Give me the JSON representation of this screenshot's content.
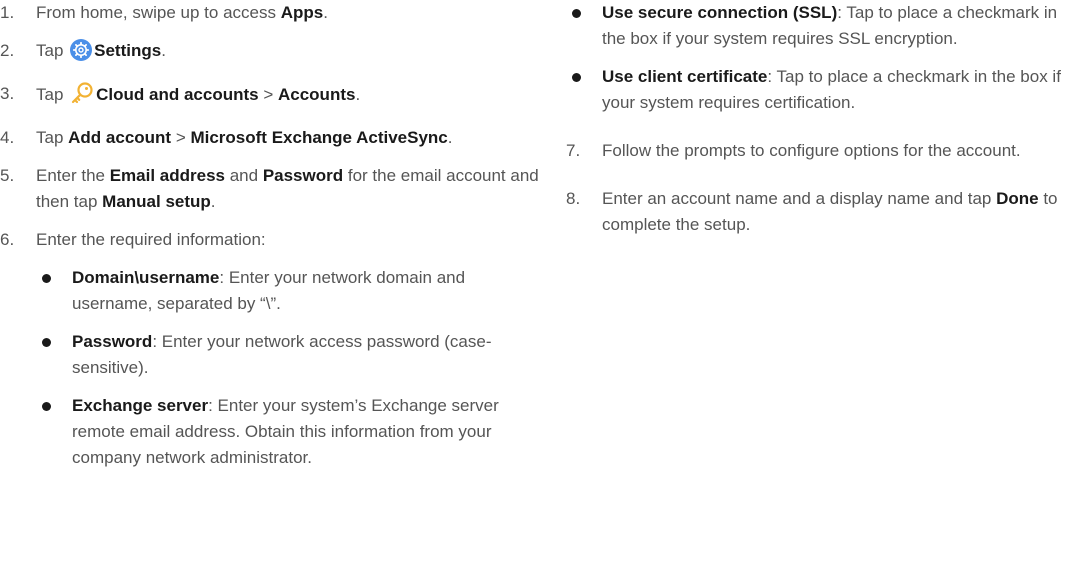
{
  "steps": [
    {
      "num": "1.",
      "pre": "From home, swipe up to access ",
      "b1": "Apps",
      "post": "."
    },
    {
      "num": "2.",
      "pre": "Tap ",
      "icon": "settings-gear-icon",
      "b1": "Settings",
      "post": "."
    },
    {
      "num": "3.",
      "pre": "Tap ",
      "icon": "key-icon",
      "b1": "Cloud and accounts",
      "sep": " > ",
      "b2": "Accounts",
      "post": "."
    },
    {
      "num": "4.",
      "pre": "Tap ",
      "b1": "Add account",
      "sep": " > ",
      "b2": "Microsoft Exchange ActiveSync",
      "post": "."
    },
    {
      "num": "5.",
      "pre": "Enter the ",
      "b1": "Email address",
      "mid": " and ",
      "b2": "Password",
      "mid2": " for the email account and then tap ",
      "b3": "Manual setup",
      "post": "."
    },
    {
      "num": "6.",
      "text": "Enter the required information:"
    },
    {
      "num": "7.",
      "text": "Follow the prompts to configure options for the account."
    },
    {
      "num": "8.",
      "pre": "Enter an account name and a display name and tap ",
      "b1": "Done",
      "post": " to complete the setup."
    }
  ],
  "bullets": [
    {
      "term": "Domain\\username",
      "desc": ": Enter your network domain and username, separated by “\\”."
    },
    {
      "term": "Password",
      "desc": ": Enter your network access password (case-sensitive)."
    },
    {
      "term": "Exchange server",
      "desc": ": Enter your system’s Exchange server remote email address. Obtain this information from your company network administrator."
    },
    {
      "term": "Use secure connection (SSL)",
      "desc": ": Tap to place a checkmark in the box if your system requires SSL encryption."
    },
    {
      "term": "Use client certificate",
      "desc": ": Tap to place a checkmark in the box if your system requires certification."
    }
  ],
  "colors": {
    "settings_icon": "#4a8fe8",
    "key_icon": "#f2b233",
    "text": "#555555",
    "bold": "#1a1a1a"
  }
}
